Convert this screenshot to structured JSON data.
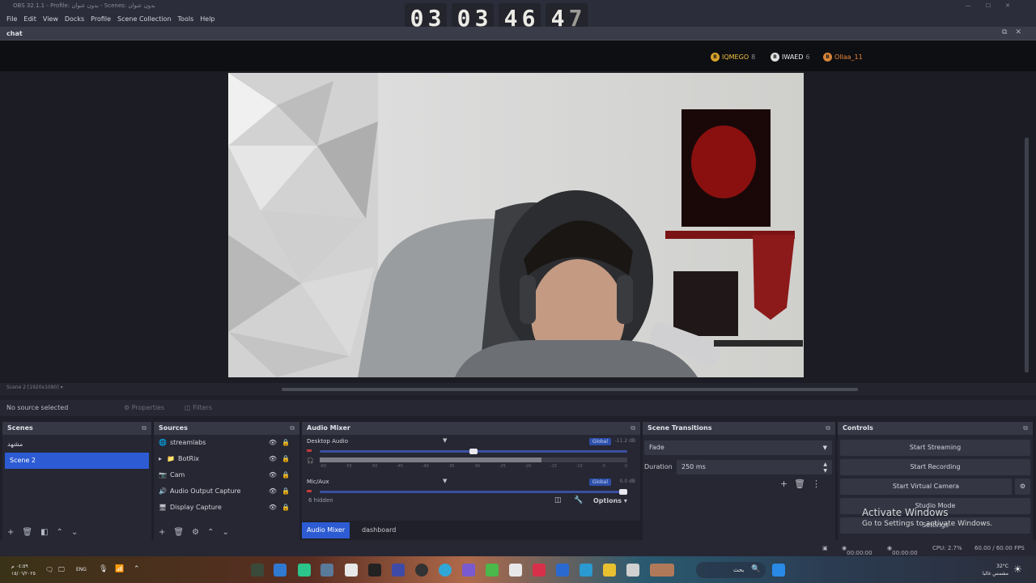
{
  "window": {
    "title": "OBS 32.1.1 - Profile: بدون عنوان - Scenes: بدون عنوان",
    "controls": [
      "—",
      "☐",
      "✕"
    ]
  },
  "menu": [
    "File",
    "Edit",
    "View",
    "Docks",
    "Profile",
    "Scene Collection",
    "Tools",
    "Help"
  ],
  "counter": {
    "pairs": [
      [
        "0",
        "3"
      ],
      [
        "0",
        "3"
      ],
      [
        "4",
        "6"
      ],
      [
        "4",
        "7"
      ]
    ]
  },
  "chat": {
    "title": "chat",
    "users": [
      {
        "name": "IQMEGO",
        "count": "8",
        "badge": "B"
      },
      {
        "name": "IWAED",
        "count": "6",
        "badge": "B"
      },
      {
        "name": "Ollaa_11",
        "count": "",
        "badge": "B"
      }
    ]
  },
  "preview": {
    "scroll_info": "Scene 2 [1920x1080] ▾"
  },
  "properties_bar": {
    "no_source": "No source selected",
    "properties": "Properties",
    "filters": "Filters"
  },
  "scenes": {
    "title": "Scenes",
    "items": [
      {
        "label": "مشهد",
        "selected": false
      },
      {
        "label": "Scene 2",
        "selected": true
      }
    ],
    "toolbar": [
      "+",
      "🗑",
      "◧",
      "⌃",
      "⌄"
    ]
  },
  "sources": {
    "title": "Sources",
    "items": [
      {
        "label": "streamlabs",
        "icon": "🌐"
      },
      {
        "label": "BotRix",
        "icon": "📁"
      },
      {
        "label": "Cam",
        "icon": "📷"
      },
      {
        "label": "Audio Output Capture",
        "icon": "🔊"
      },
      {
        "label": "Display Capture",
        "icon": "🖥"
      }
    ],
    "toolbar": [
      "+",
      "🗑",
      "⚙",
      "⌃",
      "⌄"
    ]
  },
  "audio_mixer": {
    "title": "Audio Mixer",
    "channels": [
      {
        "name": "Desktop Audio",
        "global": "Global",
        "db": "-11.2 dB",
        "volume": 0.5
      },
      {
        "name": "Mic/Aux",
        "global": "Global",
        "db": "0.0 dB",
        "volume": 1.0
      }
    ],
    "scale": [
      "-60",
      "-55",
      "-50",
      "-45",
      "-40",
      "-35",
      "-30",
      "-25",
      "-20",
      "-15",
      "-10",
      "-5",
      "0"
    ],
    "hidden": "6 hidden",
    "options": "Options",
    "tabs": [
      "Audio Mixer",
      "dashboard"
    ]
  },
  "transitions": {
    "title": "Scene Transitions",
    "type": "Fade",
    "duration_label": "Duration",
    "duration_value": "250 ms"
  },
  "controls": {
    "title": "Controls",
    "buttons": [
      "Start Streaming",
      "Start Recording",
      "Start Virtual Camera",
      "Studio Mode",
      "Settings",
      "Exit"
    ]
  },
  "watermark": {
    "line1": "Activate Windows",
    "line2": "Go to Settings to activate Windows."
  },
  "status": {
    "stream_time": "00:00:00",
    "rec_time": "00:00:00",
    "cpu": "CPU: 2.7%",
    "fps": "60.00 / 60.00 FPS"
  },
  "taskbar": {
    "clock": "٠٤:٥٩ م",
    "date": "١٥/٠٦/٢٠٢٥",
    "lang": "ENG",
    "search": "بحث",
    "weather_temp": "32°C",
    "weather_desc": "مشمس غالبا"
  }
}
